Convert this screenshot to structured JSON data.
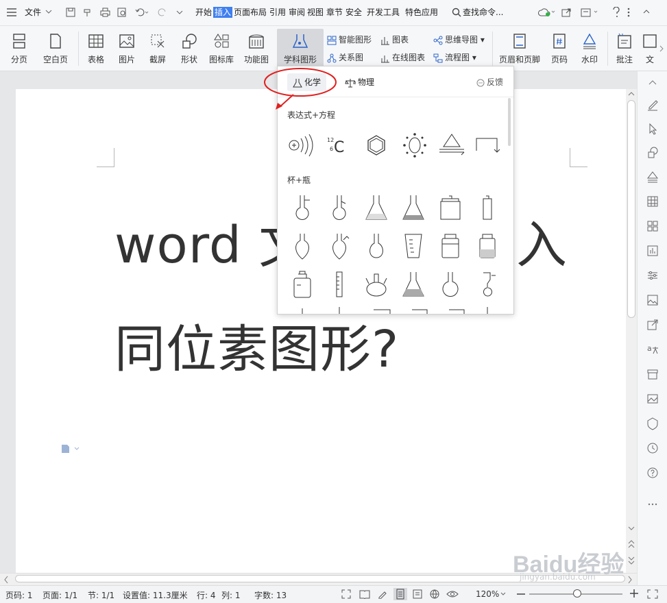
{
  "menubar": {
    "file_label": "文件",
    "tabs": [
      "开始",
      "插入",
      "页面布局",
      "引用",
      "审阅",
      "视图",
      "章节",
      "安全",
      "开发工具",
      "特色应用"
    ],
    "active_tab": "插入",
    "search_label": "查找命令..."
  },
  "ribbon": {
    "page_break": "分页",
    "blank_page": "空白页",
    "table": "表格",
    "picture": "图片",
    "screenshot": "截屏",
    "shape": "形状",
    "icon_lib": "图标库",
    "func_chart": "功能图",
    "subject_graphic": "学科图形",
    "smart_graphic": "智能图形",
    "chart": "图表",
    "mind_map": "思维导图",
    "relation": "关系图",
    "online_chart": "在线图表",
    "flowchart": "流程图",
    "header_footer": "页眉和页脚",
    "page_number": "页码",
    "watermark": "水印",
    "comment": "批注",
    "text_cut": "文"
  },
  "popup": {
    "tab_chemistry": "化学",
    "tab_physics": "物理",
    "feedback": "反馈",
    "section1": "表达式+方程",
    "section2": "杯+瓶",
    "isotope_mass": "12",
    "isotope_atomic": "6",
    "isotope_symbol": "C"
  },
  "document": {
    "line1": "word 文",
    "line1_end": "入",
    "line2": "同位素图形?"
  },
  "status": {
    "page_no": "页码: 1",
    "pages": "页面: 1/1",
    "section": "节: 1/1",
    "setting": "设置值: 11.3厘米",
    "row": "行: 4",
    "col": "列: 1",
    "words": "字数: 13",
    "zoom": "120%"
  },
  "watermark": {
    "main": "Baidu经验",
    "sub": "jingyan.baidu.com"
  },
  "colors": {
    "accent": "#3f7ff0",
    "highlight": "#e02020"
  }
}
